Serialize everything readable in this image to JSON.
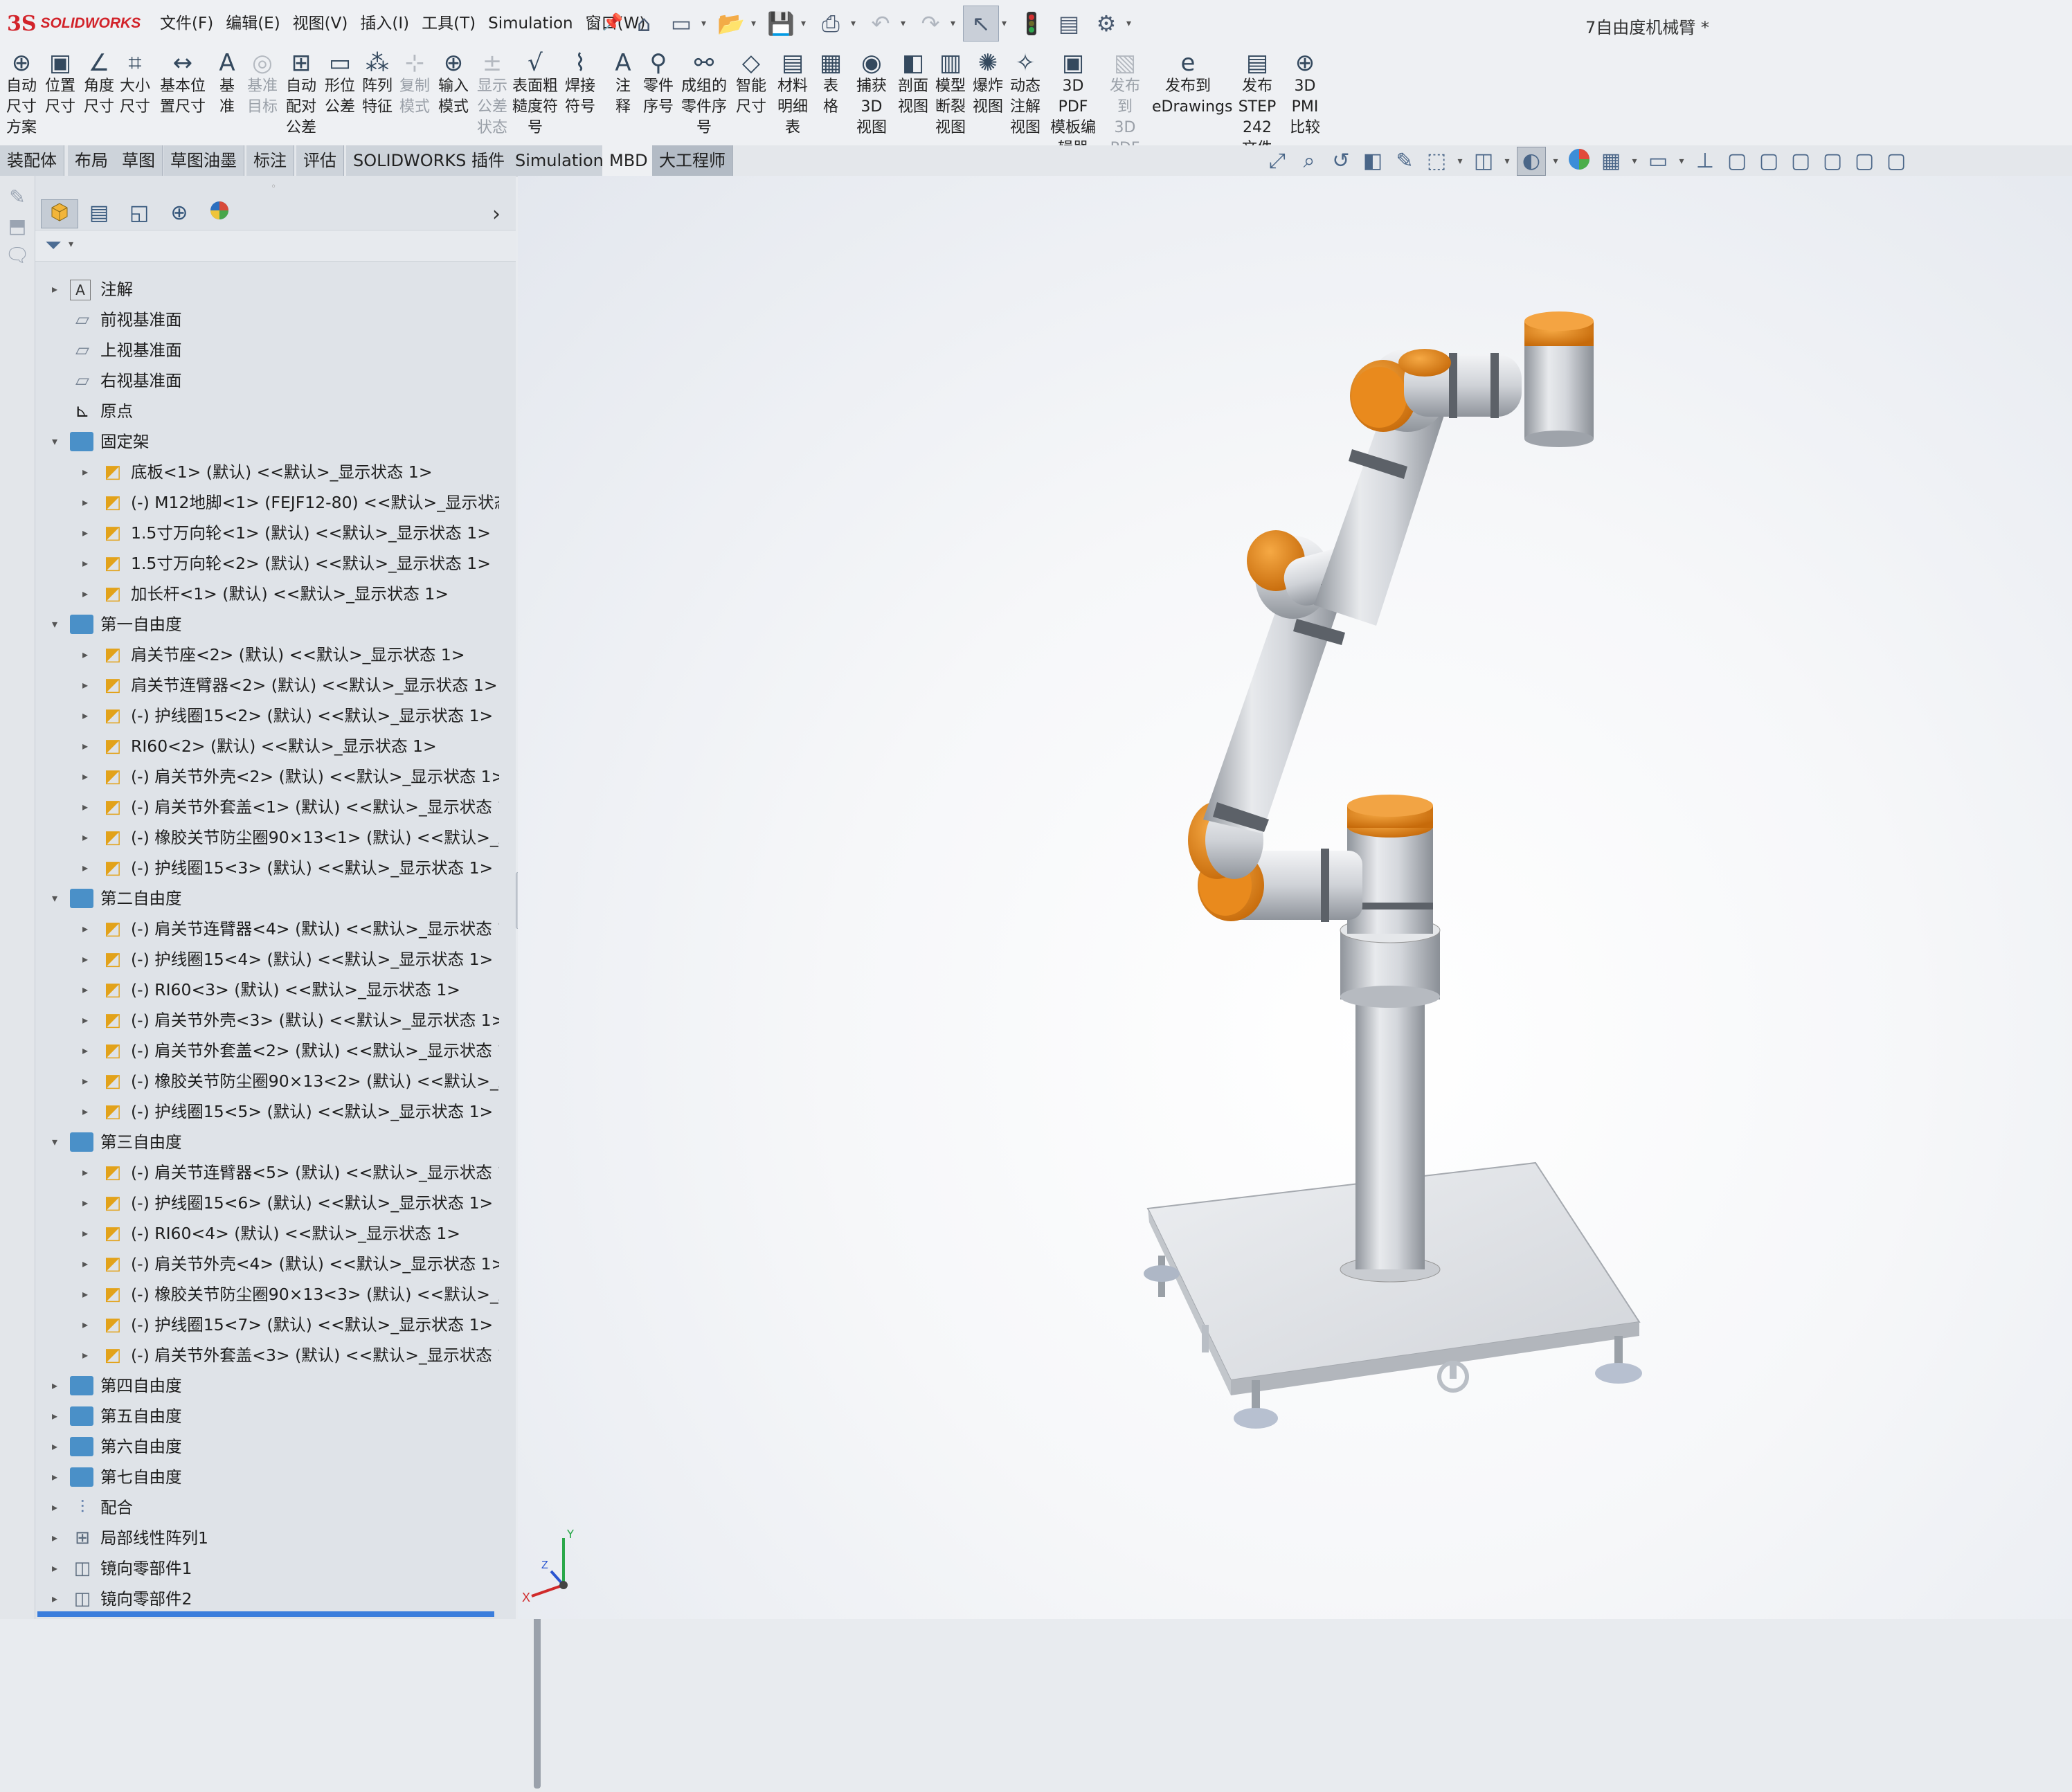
{
  "app": {
    "logo_mark": "3S",
    "logo_text": "SOLIDWORKS",
    "doc_title": "7自由度机械臂 *"
  },
  "menu": [
    "文件(F)",
    "编辑(E)",
    "视图(V)",
    "插入(I)",
    "工具(T)",
    "Simulation",
    "窗口(W)"
  ],
  "command_bar": [
    {
      "icon": "auto-dimension-icon",
      "glyph": "⊕",
      "label": [
        "自动",
        "尺寸",
        "方案"
      ],
      "enabled": true
    },
    {
      "icon": "location-dim-icon",
      "glyph": "▣",
      "label": [
        "位置",
        "尺寸"
      ],
      "enabled": true
    },
    {
      "icon": "angle-dim-icon",
      "glyph": "∠",
      "label": [
        "角度",
        "尺寸"
      ],
      "enabled": true
    },
    {
      "icon": "size-dim-icon",
      "glyph": "⌗",
      "label": [
        "大小",
        "尺寸"
      ],
      "enabled": true
    },
    {
      "icon": "basic-location-dim-icon",
      "glyph": "↔",
      "label": [
        "基本位",
        "置尺寸"
      ],
      "enabled": true
    },
    {
      "icon": "datum-icon",
      "glyph": "A",
      "label": [
        "基",
        "准"
      ],
      "enabled": true
    },
    {
      "icon": "datum-target-icon",
      "glyph": "◎",
      "label": [
        "基准",
        "目标"
      ],
      "enabled": false
    },
    {
      "icon": "auto-pair-tolerance-icon",
      "glyph": "⊞",
      "label": [
        "自动",
        "配对",
        "公差"
      ],
      "enabled": true
    },
    {
      "icon": "geometric-tolerance-icon",
      "glyph": "▭",
      "label": [
        "形位",
        "公差"
      ],
      "enabled": true
    },
    {
      "icon": "pattern-feature-icon",
      "glyph": "⁂",
      "label": [
        "阵列",
        "特征"
      ],
      "enabled": true
    },
    {
      "icon": "copy-scheme-icon",
      "glyph": "⊹",
      "label": [
        "复制",
        "模式"
      ],
      "enabled": false
    },
    {
      "icon": "import-scheme-icon",
      "glyph": "⊕",
      "label": [
        "输入",
        "模式"
      ],
      "enabled": true
    },
    {
      "icon": "show-tolerance-status-icon",
      "glyph": "±",
      "label": [
        "显示",
        "公差",
        "状态"
      ],
      "enabled": false
    },
    {
      "icon": "surface-finish-icon",
      "glyph": "√",
      "label": [
        "表面粗",
        "糙度符",
        "号"
      ],
      "enabled": true
    },
    {
      "icon": "weld-symbol-icon",
      "glyph": "⌇",
      "label": [
        "焊接",
        "符号"
      ],
      "enabled": true
    },
    {
      "icon": "note-icon",
      "glyph": "A",
      "label": [
        "注",
        "释"
      ],
      "enabled": true
    },
    {
      "icon": "balloon-icon",
      "glyph": "⚲",
      "label": [
        "零件",
        "序号"
      ],
      "enabled": true
    },
    {
      "icon": "auto-balloon-icon",
      "glyph": "⚯",
      "label": [
        "成组的",
        "零件序",
        "号"
      ],
      "enabled": true
    },
    {
      "icon": "smart-dimension-icon",
      "glyph": "◇",
      "label": [
        "智能",
        "尺寸"
      ],
      "enabled": true
    },
    {
      "icon": "bom-icon",
      "glyph": "▤",
      "label": [
        "材料",
        "明细",
        "表"
      ],
      "enabled": true
    },
    {
      "icon": "table-icon",
      "glyph": "▦",
      "label": [
        "表",
        "格"
      ],
      "enabled": true
    },
    {
      "icon": "capture-3d-view-icon",
      "glyph": "◉",
      "label": [
        "捕获",
        "3D",
        "视图"
      ],
      "enabled": true
    },
    {
      "icon": "section-view-icon",
      "glyph": "◧",
      "label": [
        "剖面",
        "视图"
      ],
      "enabled": true
    },
    {
      "icon": "model-break-view-icon",
      "glyph": "▥",
      "label": [
        "模型",
        "断裂",
        "视图"
      ],
      "enabled": true
    },
    {
      "icon": "explode-view-icon",
      "glyph": "✺",
      "label": [
        "爆炸",
        "视图"
      ],
      "enabled": true
    },
    {
      "icon": "dynamic-annotation-icon",
      "glyph": "✧",
      "label": [
        "动态",
        "注解",
        "视图"
      ],
      "enabled": true
    },
    {
      "icon": "3d-pdf-template-icon",
      "glyph": "▣",
      "label": [
        "3D PDF",
        "模板编",
        "辑器"
      ],
      "enabled": true
    },
    {
      "icon": "publish-3d-pdf-icon",
      "glyph": "▧",
      "label": [
        "发布",
        "到 3D",
        "PDF"
      ],
      "enabled": false
    },
    {
      "icon": "edrawings-icon",
      "glyph": "e",
      "label": [
        "发布到",
        "eDrawings"
      ],
      "enabled": true
    },
    {
      "icon": "step-242-icon",
      "glyph": "▤",
      "label": [
        "发布",
        "STEP 242",
        "文件"
      ],
      "enabled": true
    },
    {
      "icon": "3d-pmi-compare-icon",
      "glyph": "⊕",
      "label": [
        "3D",
        "PMI",
        "比较"
      ],
      "enabled": true
    }
  ],
  "tabs": [
    "装配体",
    "布局",
    "草图",
    "草图油墨",
    "标注",
    "评估",
    "SOLIDWORKS 插件",
    "Simulation",
    "MBD",
    "大工程师"
  ],
  "feature_tree": [
    {
      "level": 0,
      "toggle": "▸",
      "type": "anno",
      "label": "注解"
    },
    {
      "level": 0,
      "toggle": "",
      "type": "plane",
      "label": "前视基准面"
    },
    {
      "level": 0,
      "toggle": "",
      "type": "plane",
      "label": "上视基准面"
    },
    {
      "level": 0,
      "toggle": "",
      "type": "plane",
      "label": "右视基准面"
    },
    {
      "level": 0,
      "toggle": "",
      "type": "origin",
      "label": "原点"
    },
    {
      "level": 0,
      "toggle": "▾",
      "type": "folder",
      "label": "固定架"
    },
    {
      "level": 1,
      "toggle": "▸",
      "type": "part",
      "label": "底板<1> (默认) <<默认>_显示状态 1>"
    },
    {
      "level": 1,
      "toggle": "▸",
      "type": "part",
      "label": "(-) M12地脚<1> (FEJF12-80) <<默认>_显示状态"
    },
    {
      "level": 1,
      "toggle": "▸",
      "type": "part",
      "label": "1.5寸万向轮<1> (默认) <<默认>_显示状态 1>"
    },
    {
      "level": 1,
      "toggle": "▸",
      "type": "part",
      "label": "1.5寸万向轮<2> (默认) <<默认>_显示状态 1>"
    },
    {
      "level": 1,
      "toggle": "▸",
      "type": "part",
      "label": "加长杆<1> (默认) <<默认>_显示状态 1>"
    },
    {
      "level": 0,
      "toggle": "▾",
      "type": "folder",
      "label": "第一自由度"
    },
    {
      "level": 1,
      "toggle": "▸",
      "type": "part",
      "label": "肩关节座<2> (默认) <<默认>_显示状态 1>"
    },
    {
      "level": 1,
      "toggle": "▸",
      "type": "part",
      "label": "肩关节连臂器<2> (默认) <<默认>_显示状态 1>"
    },
    {
      "level": 1,
      "toggle": "▸",
      "type": "part",
      "label": "(-) 护线圈15<2> (默认) <<默认>_显示状态 1>"
    },
    {
      "level": 1,
      "toggle": "▸",
      "type": "part",
      "label": "RI60<2> (默认) <<默认>_显示状态 1>"
    },
    {
      "level": 1,
      "toggle": "▸",
      "type": "part",
      "label": "(-) 肩关节外壳<2> (默认) <<默认>_显示状态 1>"
    },
    {
      "level": 1,
      "toggle": "▸",
      "type": "part",
      "label": "(-) 肩关节外套盖<1> (默认) <<默认>_显示状态 1"
    },
    {
      "level": 1,
      "toggle": "▸",
      "type": "part",
      "label": "(-) 橡胶关节防尘圈90×13<1> (默认) <<默认>_显"
    },
    {
      "level": 1,
      "toggle": "▸",
      "type": "part",
      "label": "(-) 护线圈15<3> (默认) <<默认>_显示状态 1>"
    },
    {
      "level": 0,
      "toggle": "▾",
      "type": "folder",
      "label": "第二自由度"
    },
    {
      "level": 1,
      "toggle": "▸",
      "type": "part",
      "label": "(-) 肩关节连臂器<4> (默认) <<默认>_显示状态 1"
    },
    {
      "level": 1,
      "toggle": "▸",
      "type": "part",
      "label": "(-) 护线圈15<4> (默认) <<默认>_显示状态 1>"
    },
    {
      "level": 1,
      "toggle": "▸",
      "type": "part",
      "label": "(-) RI60<3> (默认) <<默认>_显示状态 1>"
    },
    {
      "level": 1,
      "toggle": "▸",
      "type": "part",
      "label": "(-) 肩关节外壳<3> (默认) <<默认>_显示状态 1>"
    },
    {
      "level": 1,
      "toggle": "▸",
      "type": "part",
      "label": "(-) 肩关节外套盖<2> (默认) <<默认>_显示状态 1"
    },
    {
      "level": 1,
      "toggle": "▸",
      "type": "part",
      "label": "(-) 橡胶关节防尘圈90×13<2> (默认) <<默认>_显"
    },
    {
      "level": 1,
      "toggle": "▸",
      "type": "part",
      "label": "(-) 护线圈15<5> (默认) <<默认>_显示状态 1>"
    },
    {
      "level": 0,
      "toggle": "▾",
      "type": "folder",
      "label": "第三自由度"
    },
    {
      "level": 1,
      "toggle": "▸",
      "type": "part",
      "label": "(-) 肩关节连臂器<5> (默认) <<默认>_显示状态 1"
    },
    {
      "level": 1,
      "toggle": "▸",
      "type": "part",
      "label": "(-) 护线圈15<6> (默认) <<默认>_显示状态 1>"
    },
    {
      "level": 1,
      "toggle": "▸",
      "type": "part",
      "label": "(-) RI60<4> (默认) <<默认>_显示状态 1>"
    },
    {
      "level": 1,
      "toggle": "▸",
      "type": "part",
      "label": "(-) 肩关节外壳<4> (默认) <<默认>_显示状态 1>"
    },
    {
      "level": 1,
      "toggle": "▸",
      "type": "part",
      "label": "(-) 橡胶关节防尘圈90×13<3> (默认) <<默认>_显"
    },
    {
      "level": 1,
      "toggle": "▸",
      "type": "part",
      "label": "(-) 护线圈15<7> (默认) <<默认>_显示状态 1>"
    },
    {
      "level": 1,
      "toggle": "▸",
      "type": "part",
      "label": "(-) 肩关节外套盖<3> (默认) <<默认>_显示状态 1"
    },
    {
      "level": 0,
      "toggle": "▸",
      "type": "folder",
      "label": "第四自由度"
    },
    {
      "level": 0,
      "toggle": "▸",
      "type": "folder",
      "label": "第五自由度"
    },
    {
      "level": 0,
      "toggle": "▸",
      "type": "folder",
      "label": "第六自由度"
    },
    {
      "level": 0,
      "toggle": "▸",
      "type": "folder",
      "label": "第七自由度"
    },
    {
      "level": 0,
      "toggle": "▸",
      "type": "mates",
      "label": "配合"
    },
    {
      "level": 0,
      "toggle": "▸",
      "type": "pattern",
      "label": "局部线性阵列1"
    },
    {
      "level": 0,
      "toggle": "▸",
      "type": "mirror",
      "label": "镜向零部件1"
    },
    {
      "level": 0,
      "toggle": "▸",
      "type": "mirror",
      "label": "镜向零部件2"
    }
  ],
  "triad": {
    "x": "X",
    "y": "Y",
    "z": "Z"
  },
  "colors": {
    "accent_orange": "#e8861a",
    "arm_gray": "#c9ccd1",
    "selection_blue": "#3a7ddc"
  }
}
